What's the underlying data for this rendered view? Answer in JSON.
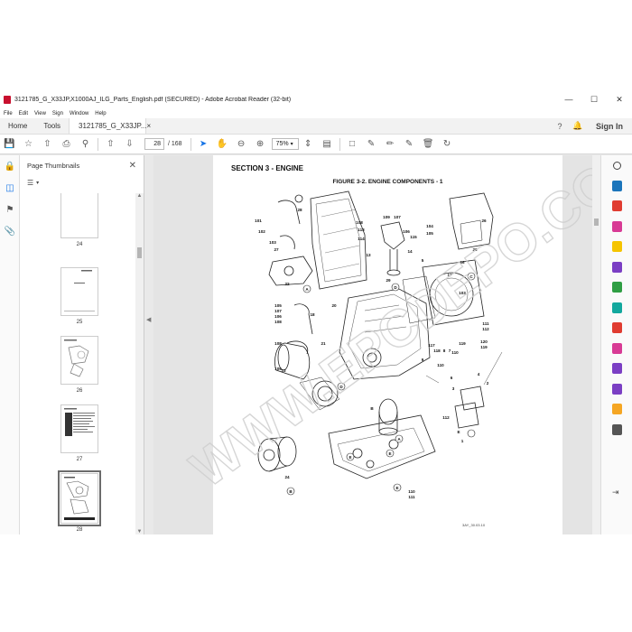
{
  "window": {
    "title": "3121785_G_X33JP,X1000AJ_ILG_Parts_English.pdf (SECURED) - Adobe Acrobat Reader (32-bit)",
    "minimize": "—",
    "maximize": "☐",
    "close": "✕"
  },
  "menu": [
    "File",
    "Edit",
    "View",
    "Sign",
    "Window",
    "Help"
  ],
  "tabs": {
    "home": "Home",
    "tools": "Tools",
    "document": "3121785_G_X33JP...",
    "doc_close": "×",
    "signin": "Sign In"
  },
  "toolbar": {
    "page_current": "28",
    "page_total": "/ 168",
    "zoom": "75%"
  },
  "thumbnails": {
    "title": "Page Thumbnails",
    "pages": [
      "24",
      "25",
      "26",
      "27",
      "28"
    ],
    "selected": "28"
  },
  "document": {
    "section_title": "SECTION 3 - ENGINE",
    "figure_title": "FIGURE 3-2. ENGINE COMPONENTS - 1",
    "figure_code": "3AY_30.03.10",
    "watermark": "WWW.EPCDEPO.COM",
    "callouts": [
      "25",
      "26",
      "28",
      "101",
      "102",
      "103",
      "27",
      "A",
      "108",
      "113",
      "114",
      "109",
      "107",
      "106",
      "115",
      "13",
      "14",
      "D",
      "104",
      "105",
      "C",
      "26",
      "5",
      "16",
      "111",
      "112",
      "103",
      "17",
      "22",
      "29",
      "105",
      "107",
      "106",
      "108",
      "20",
      "18",
      "21",
      "108",
      "109",
      "117",
      "118",
      "8",
      "7",
      "110",
      "119",
      "120",
      "119",
      "110",
      "9",
      "D",
      "B",
      "23",
      "6",
      "3",
      "2",
      "4",
      "112",
      "E",
      "1",
      "E",
      "24",
      "B",
      "110",
      "111",
      "E",
      "E",
      "A"
    ]
  },
  "colors": {
    "accent": "#1473e6",
    "acrobat_red": "#c8102e",
    "watermark": "#d0d0d0"
  }
}
